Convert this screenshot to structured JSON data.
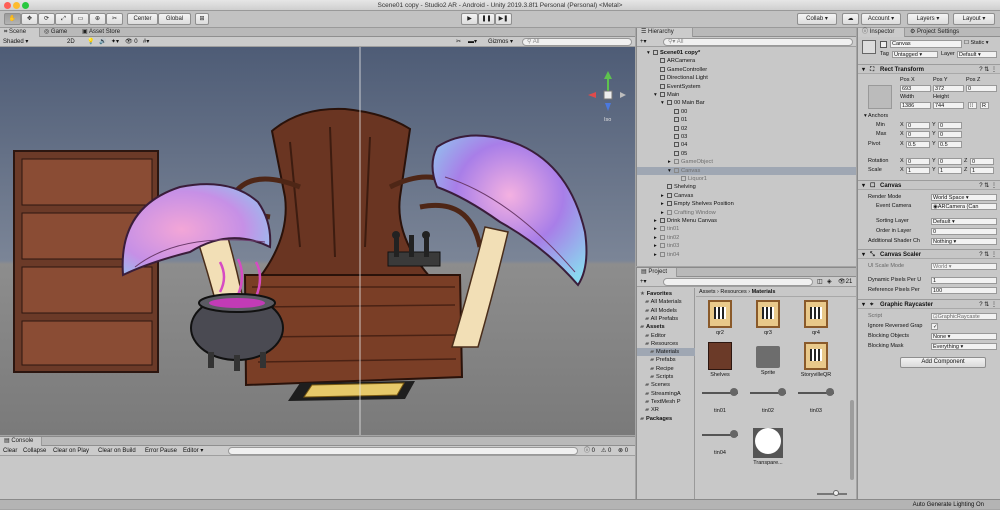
{
  "window": {
    "title": "Scene01 copy - Studio2 AR - Android - Unity 2019.3.8f1 Personal (Personal) <Metal>"
  },
  "toolbar": {
    "center": "Center",
    "global": "Global",
    "collab": "Collab",
    "account": "Account",
    "layers": "Layers",
    "layout": "Layout"
  },
  "scene_panel": {
    "tabs": [
      "Scene",
      "Game",
      "Asset Store"
    ],
    "shading": "Shaded",
    "mode2d": "2D",
    "gizmos": "Gizmos",
    "search_all": "All",
    "persp": "Iso",
    "scene_view_count": "0"
  },
  "console": {
    "tab": "Console",
    "buttons": [
      "Clear",
      "Collapse",
      "Clear on Play",
      "Clear on Build",
      "Error Pause",
      "Editor"
    ],
    "counts": [
      "0",
      "0",
      "0"
    ]
  },
  "hierarchy": {
    "tab": "Hierarchy",
    "search": "All",
    "items": [
      {
        "label": "Scene01 copy*",
        "bold": true
      },
      {
        "label": "ARCamera"
      },
      {
        "label": "GameController"
      },
      {
        "label": "Directional Light"
      },
      {
        "label": "EventSystem"
      },
      {
        "label": "Main"
      },
      {
        "label": "00 Main Bar"
      },
      {
        "label": "00"
      },
      {
        "label": "01"
      },
      {
        "label": "02"
      },
      {
        "label": "03"
      },
      {
        "label": "04"
      },
      {
        "label": "05"
      },
      {
        "label": "GameObject",
        "dim": true
      },
      {
        "label": "Canvas",
        "dim": true,
        "selected": true
      },
      {
        "label": "Liquor1",
        "dim": true
      },
      {
        "label": "Shelving"
      },
      {
        "label": "Canvas"
      },
      {
        "label": "Empty Shelves Position"
      },
      {
        "label": "Crafting Window",
        "dim": true
      },
      {
        "label": "Drink Menu Canvas"
      },
      {
        "label": "tin01",
        "dim": true
      },
      {
        "label": "tin02",
        "dim": true
      },
      {
        "label": "tin03",
        "dim": true
      },
      {
        "label": "tin04",
        "dim": true
      }
    ]
  },
  "project": {
    "tab": "Project",
    "count": "21",
    "breadcrumb": [
      "Assets",
      "Resources",
      "Materials"
    ],
    "tree": [
      {
        "label": "Favorites",
        "bold": true
      },
      {
        "label": "All Materials"
      },
      {
        "label": "All Models"
      },
      {
        "label": "All Prefabs"
      },
      {
        "label": "Assets",
        "bold": true
      },
      {
        "label": "Editor"
      },
      {
        "label": "Resources"
      },
      {
        "label": "Materials",
        "selected": true
      },
      {
        "label": "Prefabs"
      },
      {
        "label": "Recipe"
      },
      {
        "label": "Scripts"
      },
      {
        "label": "Scenes"
      },
      {
        "label": "StreamingA"
      },
      {
        "label": "TextMesh P"
      },
      {
        "label": "XR"
      },
      {
        "label": "Packages",
        "bold": true
      }
    ],
    "assets": [
      "qr2",
      "qr3",
      "qr4",
      "Shelves",
      "Sprite",
      "StoryvilleQR",
      "tin01",
      "tin02",
      "tin03",
      "tin04",
      "Transpare..."
    ]
  },
  "inspector": {
    "tabs": [
      "Inspector",
      "Project Settings"
    ],
    "object_name": "Canvas",
    "static": "Static",
    "tag_label": "Tag",
    "tag": "Untagged",
    "layer_label": "Layer",
    "layer": "Default",
    "rect": {
      "title": "Rect Transform",
      "posx_l": "Pos X",
      "posy_l": "Pos Y",
      "posz_l": "Pos Z",
      "posx": "693",
      "posy": "372",
      "posz": "0",
      "w_l": "Width",
      "h_l": "Height",
      "w": "1386",
      "h": "744",
      "anchors": "Anchors",
      "min": "Min",
      "max": "Max",
      "pivot": "Pivot",
      "rotation": "Rotation",
      "scale": "Scale",
      "x": "X",
      "y": "Y",
      "z": "Z",
      "minx": "0",
      "miny": "0",
      "maxx": "0",
      "maxy": "0",
      "pivx": "0.5",
      "pivy": "0.5",
      "rotx": "0",
      "roty": "0",
      "rotz": "0",
      "scx": "1",
      "scy": "1",
      "scz": "1",
      "r": "R"
    },
    "canvas": {
      "title": "Canvas",
      "render_mode_l": "Render Mode",
      "render_mode": "World Space",
      "event_camera_l": "Event Camera",
      "event_camera": "ARCamera (Can",
      "sorting_layer_l": "Sorting Layer",
      "sorting_layer": "Default",
      "order_l": "Order in Layer",
      "order": "0",
      "shader_l": "Additional Shader Ch",
      "shader": "Nothing"
    },
    "scaler": {
      "title": "Canvas Scaler",
      "ui_scale_l": "UI Scale Mode",
      "ui_scale": "World",
      "dpu_l": "Dynamic Pixels Per U",
      "dpu": "1",
      "rppu_l": "Reference Pixels Per",
      "rppu": "100"
    },
    "raycaster": {
      "title": "Graphic Raycaster",
      "script_l": "Script",
      "script": "GraphicRaycaste",
      "ignore_l": "Ignore Reversed Grap",
      "block_obj_l": "Blocking Objects",
      "block_obj": "None",
      "block_mask_l": "Blocking Mask",
      "block_mask": "Everything"
    },
    "add_component": "Add Component"
  },
  "status": {
    "text": "Auto Generate Lighting On"
  },
  "colors": {
    "accent": "#3a72d8",
    "panel": "#c8c8c8",
    "scene_sky": "#5d6d86",
    "scene_ground": "#8a8a8a"
  }
}
